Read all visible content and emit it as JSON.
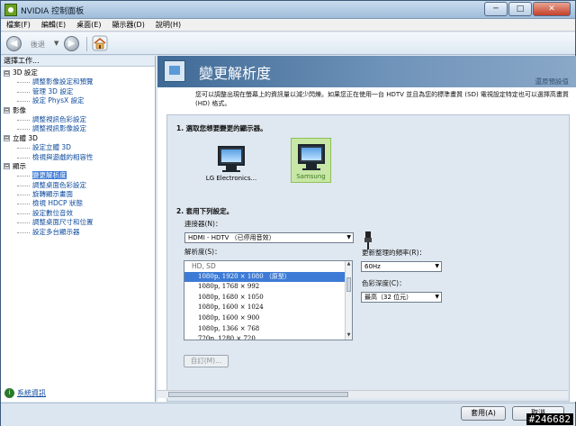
{
  "window": {
    "title": "NVIDIA 控制面板"
  },
  "window_controls": {
    "minimize": "─",
    "maximize": "□",
    "close": "✕"
  },
  "menu": [
    "檔案(F)",
    "編輯(E)",
    "桌面(E)",
    "顯示器(D)",
    "說明(H)"
  ],
  "toolbar": {
    "back_label": "後退",
    "dropdown": "▼"
  },
  "sidebar": {
    "header": "選擇工作...",
    "tree": [
      {
        "type": "cat",
        "label": "3D 設定",
        "expander": "⊟"
      },
      {
        "type": "item",
        "label": "調整影像設定和預覽"
      },
      {
        "type": "item",
        "label": "管理 3D 設定"
      },
      {
        "type": "item",
        "label": "設定 PhysX 設定"
      },
      {
        "type": "cat",
        "label": "影像",
        "expander": "⊟"
      },
      {
        "type": "item",
        "label": "調整視訊色彩設定"
      },
      {
        "type": "item",
        "label": "調整視訊影像設定"
      },
      {
        "type": "cat",
        "label": "立體 3D",
        "expander": "⊟"
      },
      {
        "type": "item",
        "label": "設定立體 3D"
      },
      {
        "type": "item",
        "label": "檢視與遊戲的相容性"
      },
      {
        "type": "cat",
        "label": "顯示",
        "expander": "⊟"
      },
      {
        "type": "item",
        "label": "變更解析度",
        "selected": true
      },
      {
        "type": "item",
        "label": "調整桌面色彩設定"
      },
      {
        "type": "item",
        "label": "旋轉顯示畫面"
      },
      {
        "type": "item",
        "label": "檢視 HDCP 狀態"
      },
      {
        "type": "item",
        "label": "設定數位音效"
      },
      {
        "type": "item",
        "label": "調整桌面尺寸和位置"
      },
      {
        "type": "item",
        "label": "設定多台顯示器"
      }
    ],
    "system_info": "系統資訊",
    "system_info_icon": "i"
  },
  "main": {
    "title": "變更解析度",
    "restore": "還原預設值",
    "description": "您可以調整出現在螢幕上的資訊量以減少閃爍。如果您正在使用一台 HDTV 並且為您的標準畫質 (SD) 電視設定特定也可以選擇高畫質 (HD) 格式。",
    "section1": "1. 選取您想要變更的顯示器。",
    "displays": [
      {
        "label": "LG Electronics...",
        "selected": false
      },
      {
        "label": "Samsung",
        "selected": true
      }
    ],
    "section2": "2. 套用下列設定。",
    "connector_label": "連接器(N)：",
    "connector_value": "HDMI - HDTV （已停用音效）",
    "resolution_label": "解析度(S)：",
    "resolution_group": "HD, SD",
    "resolutions": [
      {
        "label": "1080p, 1920 × 1080 （原型）",
        "selected": true
      },
      {
        "label": "1080p, 1768 × 992",
        "selected": false
      },
      {
        "label": "1080p, 1680 × 1050",
        "selected": false
      },
      {
        "label": "1080p, 1600 × 1024",
        "selected": false
      },
      {
        "label": "1080p, 1600 × 900",
        "selected": false
      },
      {
        "label": "1080p, 1366 × 768",
        "selected": false
      },
      {
        "label": "720p, 1280 × 720",
        "selected": false
      }
    ],
    "refresh_label": "更新整理的頻率(R)：",
    "refresh_value": "60Hz",
    "color_depth_label": "色彩深度(C)：",
    "color_depth_value": "最高（32 位元）",
    "custom_button": "自訂(M)..."
  },
  "footer": {
    "apply": "套用(A)",
    "cancel": "取消"
  },
  "watermark": "#246682",
  "colors": {
    "accent": "#3d7bd6",
    "link": "#0c4a9c",
    "selected_display": "#c8e6a6"
  }
}
